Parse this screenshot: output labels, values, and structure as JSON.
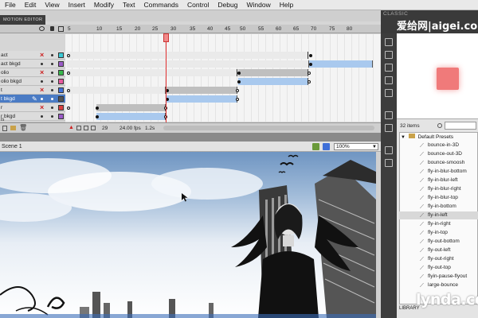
{
  "menu": [
    "File",
    "Edit",
    "View",
    "Insert",
    "Modify",
    "Text",
    "Commands",
    "Control",
    "Debug",
    "Window",
    "Help"
  ],
  "workspace_label": "CLASSIC",
  "watermark": "爱给网|aigei.com",
  "timeline": {
    "tab_label": "MOTION EDITOR",
    "frame_numbers": [
      "5",
      "10",
      "15",
      "20",
      "25",
      "30",
      "35",
      "40",
      "45",
      "50",
      "55",
      "60",
      "65",
      "70",
      "75",
      "80"
    ],
    "layers": [
      {
        "name": "act",
        "locked": true,
        "color": "#3ccad6"
      },
      {
        "name": "act bkgd",
        "locked": false,
        "color": "#9b5cc8"
      },
      {
        "name": "olio",
        "locked": true,
        "color": "#38b84c"
      },
      {
        "name": "olio bkgd",
        "locked": false,
        "color": "#e75a9e"
      },
      {
        "name": "t",
        "locked": true,
        "color": "#3f6fd8"
      },
      {
        "name": "t bkgd",
        "locked": false,
        "color": "#555555",
        "selected": true
      },
      {
        "name": "r",
        "locked": true,
        "color": "#d94040"
      },
      {
        "name": "r bkgd",
        "locked": false,
        "color": "#9b5cc8"
      },
      {
        "name": "ls",
        "locked": false,
        "color": "#38b84c"
      }
    ],
    "current_frame": "29",
    "fps": "24.00 fps",
    "time": "1.2s"
  },
  "stage": {
    "scene": "Scene 1",
    "zoom": "100%"
  },
  "presets": {
    "count": "32 items",
    "folder": "Default Presets",
    "items": [
      "bounce-in-3D",
      "bounce-out-3D",
      "bounce-smoosh",
      "fly-in-blur-bottom",
      "fly-in-blur-left",
      "fly-in-blur-right",
      "fly-in-blur-top",
      "fly-in-bottom",
      "fly-in-left",
      "fly-in-right",
      "fly-in-top",
      "fly-out-bottom",
      "fly-out-left",
      "fly-out-right",
      "fly-out-top",
      "flyin-pause-flyout",
      "large-bounce"
    ],
    "selected_item": "fly-in-left",
    "library_label": "LIBRARY"
  },
  "brand": "lynda.com",
  "colors": {
    "playhead": "#e23030",
    "tween_blue": "#a9c9ee",
    "selected_layer": "#4a7bc4",
    "preview_square": "#f07a7a"
  }
}
